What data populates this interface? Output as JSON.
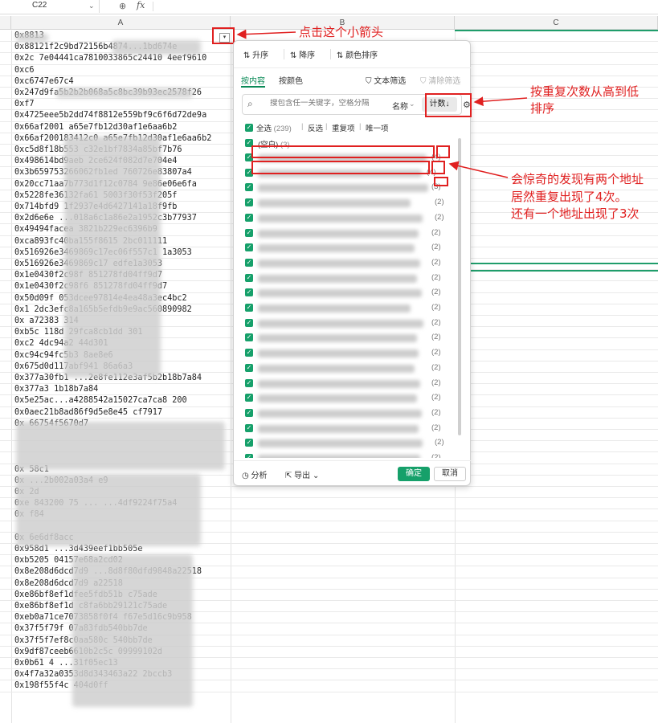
{
  "formula_bar": {
    "name_box": "C22",
    "fx": "fx"
  },
  "columns": [
    "A",
    "B",
    "C"
  ],
  "cells_a": [
    "0x8813",
    "0x88121f2c9bd72156b4874...1bd674e",
    "0x2c  7e04441ca7810033865c24410  4eef9610",
    "0xc6",
    "0xc6747e67c4",
    "0x247d9fa5b2b2b068a5c8bc39b93ec2578f26",
    "0xf7",
    "0x4725eee5b2dd74f8812e559bf9c6f6d72de9a",
    "0x66af2001            a65e7fb12d30af1e6aa6b2",
    "0x66af200183412c0     a65e7fb12d30af1e6aa6b2",
    "0xc5d8f18b553         c32e1bf7834a85bf7b76",
    "0x498614bd9aeb       2ce624f082d7e704e4",
    "0x3b659753266062fb1ed     760726e83807a4",
    "0x20cc71aa7b773d1f12c0784     9e86e06e6fa",
    "0x5228fe36132fa61         5003f30f53f205f",
    "0x714bfd9      1f2937e4d6427141a18f9fb",
    "0x2d6e6e     ...018a6c1a86e2a1952c3b77937",
    "0x49494facea       3821b229ec6396b9",
    "0xca893fc40ba155f8615     2bc011111",
    "0x516926e3469869c17ec06f557c1     1a3053",
    "0x516926e3469869c17            edfe1a3053",
    "0x1e0430f2c98f         851278fd04ff9d7",
    "0x1e0430f2c98f6        851278fd04ff9d7",
    "0x50d09f      053dcee97814e4ea48a3ec4bc2",
    "0x1    2dc3efc8a165b5efdb9e9ac560890982",
    "0x     a72383         314",
    "0xb5c        118d     29fca8cb1dd    301",
    "0xc2          4dc94a2    44d301",
    "0xc94c94fc5b3               8ae8e6",
    "0x675d0d117abf941               86a6a3",
    "0x377a30fb1    ...2e8fe112e3af5b2b18b7a84",
    "0x377a3                   1b18b7a84",
    "0x5e25ac...a4288542a15027ca7ca8      200",
    "0x0aec21b8ad86f9d5e8e45            cf7917",
    "0x                       66754f5670d7",
    "",
    "",
    "",
    "0x                              58c1",
    "0x            ...2b002a03a4   e9",
    "0x                   2d",
    "0xe   843200  75  ...  ...4df9224f75a4",
    "0x                  f84",
    "",
    "0x                    6e6df8acc",
    "0x958d1         ...3d439eef1bb505e",
    "0xb5205          04157e68a2cd02",
    "0x8e208d6dcd7d9   ...8d8f80dfd9848a22518",
    "0x8e208d6dcd7d9             a22518",
    "0xe86bf8ef1dfee5fdb51b       c75ade",
    "0xe86bf8ef1d      c8fa6bb29121c75ade",
    "0xeb0a71ce7073858f0f4    f67e5d16c9b958",
    "0x37f5f79f        07a83fdb540bb7de",
    "0x37f5f7ef8c0aa580c       540bb7de",
    "0x9df87ceeb6610b2c5c       09999102d",
    "0x0b61         4  ...31f05ec13",
    "0x4f7a32a0353d8d343463a22  2bccb3",
    "0x198f55f4c              404d0ff"
  ],
  "panel": {
    "sort": {
      "asc": "升序",
      "desc": "降序",
      "color": "颜色排序"
    },
    "tabs": {
      "by_content": "按内容",
      "by_color": "按颜色"
    },
    "text_filter": "文本筛选",
    "clear_filter": "清除筛选",
    "search_placeholder": "搜包含任一关键字，空格分隔",
    "name_label": "名称",
    "count_label": "计数↓",
    "quick": {
      "select_all": "全选",
      "select_all_count": "(239)",
      "invert": "反选",
      "duplicates": "重复项",
      "unique": "唯一项"
    },
    "blank_item": {
      "label": "(空白)",
      "count": "(3)"
    },
    "list_counts": [
      "(4)",
      "(4)",
      "(3)",
      "(2)",
      "(2)",
      "(2)",
      "(2)",
      "(2)",
      "(2)",
      "(2)",
      "(2)",
      "(2)",
      "(2)",
      "(2)",
      "(2)",
      "(2)",
      "(2)",
      "(2)",
      "(2)",
      "(2)",
      "(2)"
    ],
    "footer": {
      "analyze": "分析",
      "export": "导出",
      "ok": "确定",
      "cancel": "取消"
    }
  },
  "annotations": {
    "click_arrow": "点击这个小箭头",
    "sort_by_count": [
      "按重复次数从高到低",
      "排序"
    ],
    "finding": [
      "会惊奇的发现有两个地址",
      "居然重复出现了4次。",
      "还有一个地址出现了3次"
    ]
  },
  "colors": {
    "accent": "#16a06a",
    "annotation": "#e02020"
  }
}
